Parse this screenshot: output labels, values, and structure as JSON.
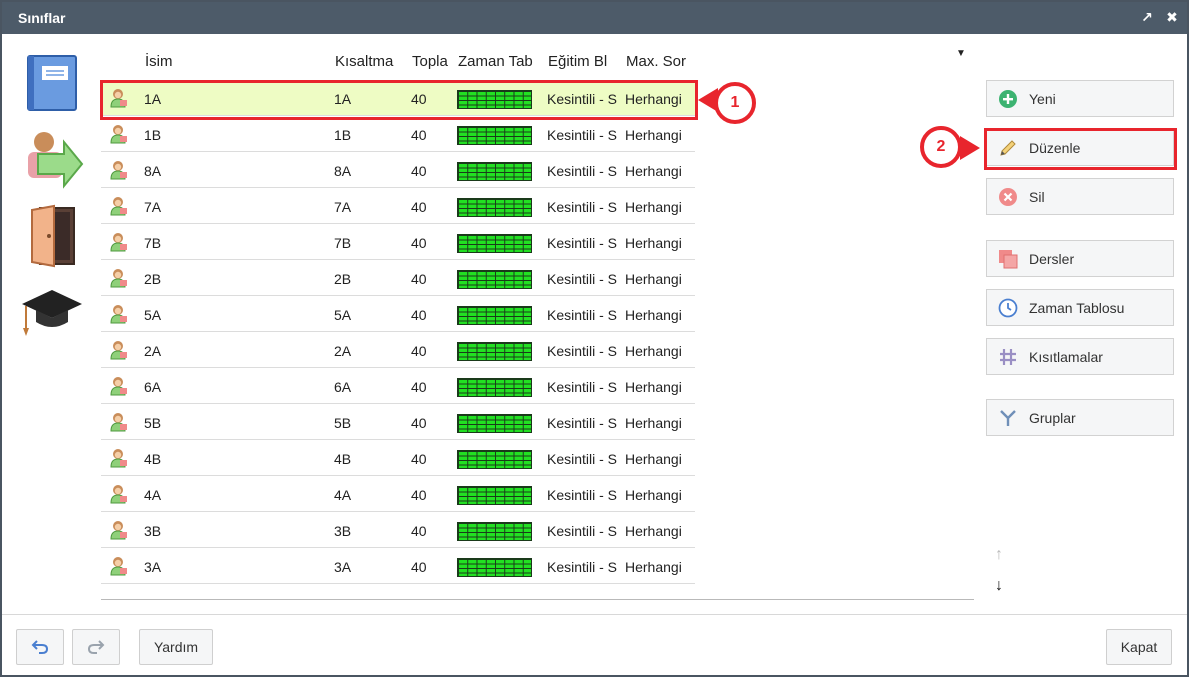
{
  "window": {
    "title": "Sınıflar"
  },
  "left_icons": [
    "notebook-icon",
    "move-people-icon",
    "door-icon",
    "graduation-cap-icon"
  ],
  "table": {
    "headers": [
      "İsim",
      "Kısaltma",
      "Topla",
      "Zaman Tab",
      "Eğitim Bl",
      "Max. Sor"
    ],
    "rows": [
      {
        "name": "1A",
        "abbr": "1A",
        "total": "40",
        "edu": "Kesintili - S",
        "max": "Herhangi"
      },
      {
        "name": "1B",
        "abbr": "1B",
        "total": "40",
        "edu": "Kesintili - S",
        "max": "Herhangi"
      },
      {
        "name": "8A",
        "abbr": "8A",
        "total": "40",
        "edu": "Kesintili - S",
        "max": "Herhangi"
      },
      {
        "name": "7A",
        "abbr": "7A",
        "total": "40",
        "edu": "Kesintili - S",
        "max": "Herhangi"
      },
      {
        "name": "7B",
        "abbr": "7B",
        "total": "40",
        "edu": "Kesintili - S",
        "max": "Herhangi"
      },
      {
        "name": "2B",
        "abbr": "2B",
        "total": "40",
        "edu": "Kesintili - S",
        "max": "Herhangi"
      },
      {
        "name": "5A",
        "abbr": "5A",
        "total": "40",
        "edu": "Kesintili - S",
        "max": "Herhangi"
      },
      {
        "name": "2A",
        "abbr": "2A",
        "total": "40",
        "edu": "Kesintili - S",
        "max": "Herhangi"
      },
      {
        "name": "6A",
        "abbr": "6A",
        "total": "40",
        "edu": "Kesintili - S",
        "max": "Herhangi"
      },
      {
        "name": "5B",
        "abbr": "5B",
        "total": "40",
        "edu": "Kesintili - S",
        "max": "Herhangi"
      },
      {
        "name": "4B",
        "abbr": "4B",
        "total": "40",
        "edu": "Kesintili - S",
        "max": "Herhangi"
      },
      {
        "name": "4A",
        "abbr": "4A",
        "total": "40",
        "edu": "Kesintili - S",
        "max": "Herhangi"
      },
      {
        "name": "3B",
        "abbr": "3B",
        "total": "40",
        "edu": "Kesintili - S",
        "max": "Herhangi"
      },
      {
        "name": "3A",
        "abbr": "3A",
        "total": "40",
        "edu": "Kesintili - S",
        "max": "Herhangi"
      }
    ],
    "selected_index": 0
  },
  "callouts": {
    "one": "1",
    "two": "2"
  },
  "actions": {
    "yeni": "Yeni",
    "duzenle": "Düzenle",
    "sil": "Sil",
    "dersler": "Dersler",
    "zaman_tablosu": "Zaman Tablosu",
    "kisitlamalar": "Kısıtlamalar",
    "gruplar": "Gruplar"
  },
  "footer": {
    "help": "Yardım",
    "close": "Kapat"
  },
  "colors": {
    "accent_red": "#e8252d",
    "titlebar": "#4d5b69",
    "selected_row": "#eefcc4",
    "timetable_green": "#22e022"
  }
}
